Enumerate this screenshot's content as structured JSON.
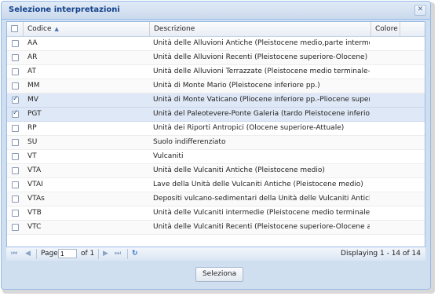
{
  "window": {
    "title": "Selezione interpretazioni",
    "close_icon": "✕"
  },
  "grid": {
    "columns": {
      "codice": "Codice",
      "descrizione": "Descrizione",
      "colore": "Colore"
    },
    "rows": [
      {
        "code": "AA",
        "desc": "Unità delle Alluvioni Antiche (Pleistocene medio,parte intermedia)",
        "checked": false
      },
      {
        "code": "AR",
        "desc": "Unità delle Alluvioni Recenti (Pleistocene superiore-Olocene)",
        "checked": false
      },
      {
        "code": "AT",
        "desc": "Unità delle Alluvioni Terrazzate (Pleistocene medio terminale-Pleistoc...",
        "checked": false
      },
      {
        "code": "MM",
        "desc": "Unità di Monte Mario (Pleistocene inferiore pp.)",
        "checked": false
      },
      {
        "code": "MV",
        "desc": "Unità di Monte Vaticano (Pliocene inferiore pp.-Pliocene superiore pp.)",
        "checked": true
      },
      {
        "code": "PGT",
        "desc": "Unità del Paleotevere-Ponte Galeria (tardo Pleistocene inferiore-Pleis...",
        "checked": true
      },
      {
        "code": "RP",
        "desc": "Unità dei Riporti Antropici (Olocene superiore-Attuale)",
        "checked": false
      },
      {
        "code": "SU",
        "desc": "Suolo indifferenziato",
        "checked": false
      },
      {
        "code": "VT",
        "desc": "Vulcaniti",
        "checked": false
      },
      {
        "code": "VTA",
        "desc": "Unità delle Vulcaniti Antiche (Pleistocene medio)",
        "checked": false
      },
      {
        "code": "VTAI",
        "desc": "Lave della Unità delle Vulcaniti Antiche (Pleistocene medio)",
        "checked": false
      },
      {
        "code": "VTAs",
        "desc": "Depositi vulcano-sedimentari della Unità delle Vulcaniti Antiche (Pleis...",
        "checked": false
      },
      {
        "code": "VTB",
        "desc": "Unità delle Vulcaniti intermedie (Pleistocene medio terminale-Pleistoc...",
        "checked": false
      },
      {
        "code": "VTC",
        "desc": "Unità delle Vulcaniti Recenti (Pleistocene superiore-Olocene antico)",
        "checked": false
      }
    ]
  },
  "paging": {
    "page_label": "Page",
    "page_value": "1",
    "of_label": "of 1",
    "display_text": "Displaying 1 - 14 of 14",
    "icons": {
      "first": "⏮",
      "prev": "◀",
      "next": "▶",
      "last": "⏭",
      "refresh": "↻"
    }
  },
  "footer": {
    "select_label": "Seleziona"
  }
}
